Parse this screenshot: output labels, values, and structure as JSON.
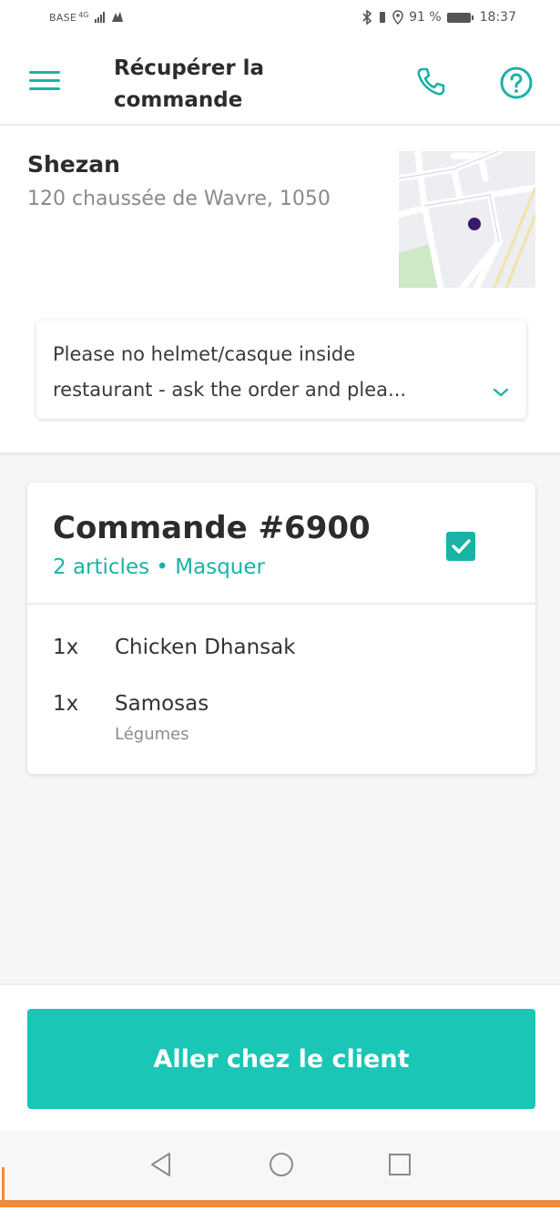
{
  "status_bar": {
    "carrier": "BASE",
    "network": "4G",
    "battery": "91 %",
    "time": "18:37"
  },
  "header": {
    "title": "Récupérer la commande"
  },
  "restaurant": {
    "name": "Shezan",
    "address": "120 chaussée de Wavre, 1050"
  },
  "note": {
    "line1": "Please no helmet/casque inside",
    "line2": "restaurant - ask the order and plea..."
  },
  "order": {
    "title": "Commande #6900",
    "item_count": "2 articles",
    "separator": "•",
    "toggle_label": "Masquer",
    "checked": true,
    "items": [
      {
        "qty": "1x",
        "name": "Chicken Dhansak",
        "option": ""
      },
      {
        "qty": "1x",
        "name": "Samosas",
        "option": "Légumes"
      }
    ]
  },
  "footer": {
    "cta_label": "Aller chez le client"
  },
  "colors": {
    "accent": "#19b3a6",
    "cta": "#1ac6b6",
    "map_marker": "#3a1a6a"
  },
  "icons": {
    "menu": "hamburger-icon",
    "call": "phone-icon",
    "help": "question-circle-icon",
    "expand": "chevron-down-icon",
    "back": "triangle-back-icon",
    "home": "circle-home-icon",
    "recents": "square-recents-icon"
  }
}
